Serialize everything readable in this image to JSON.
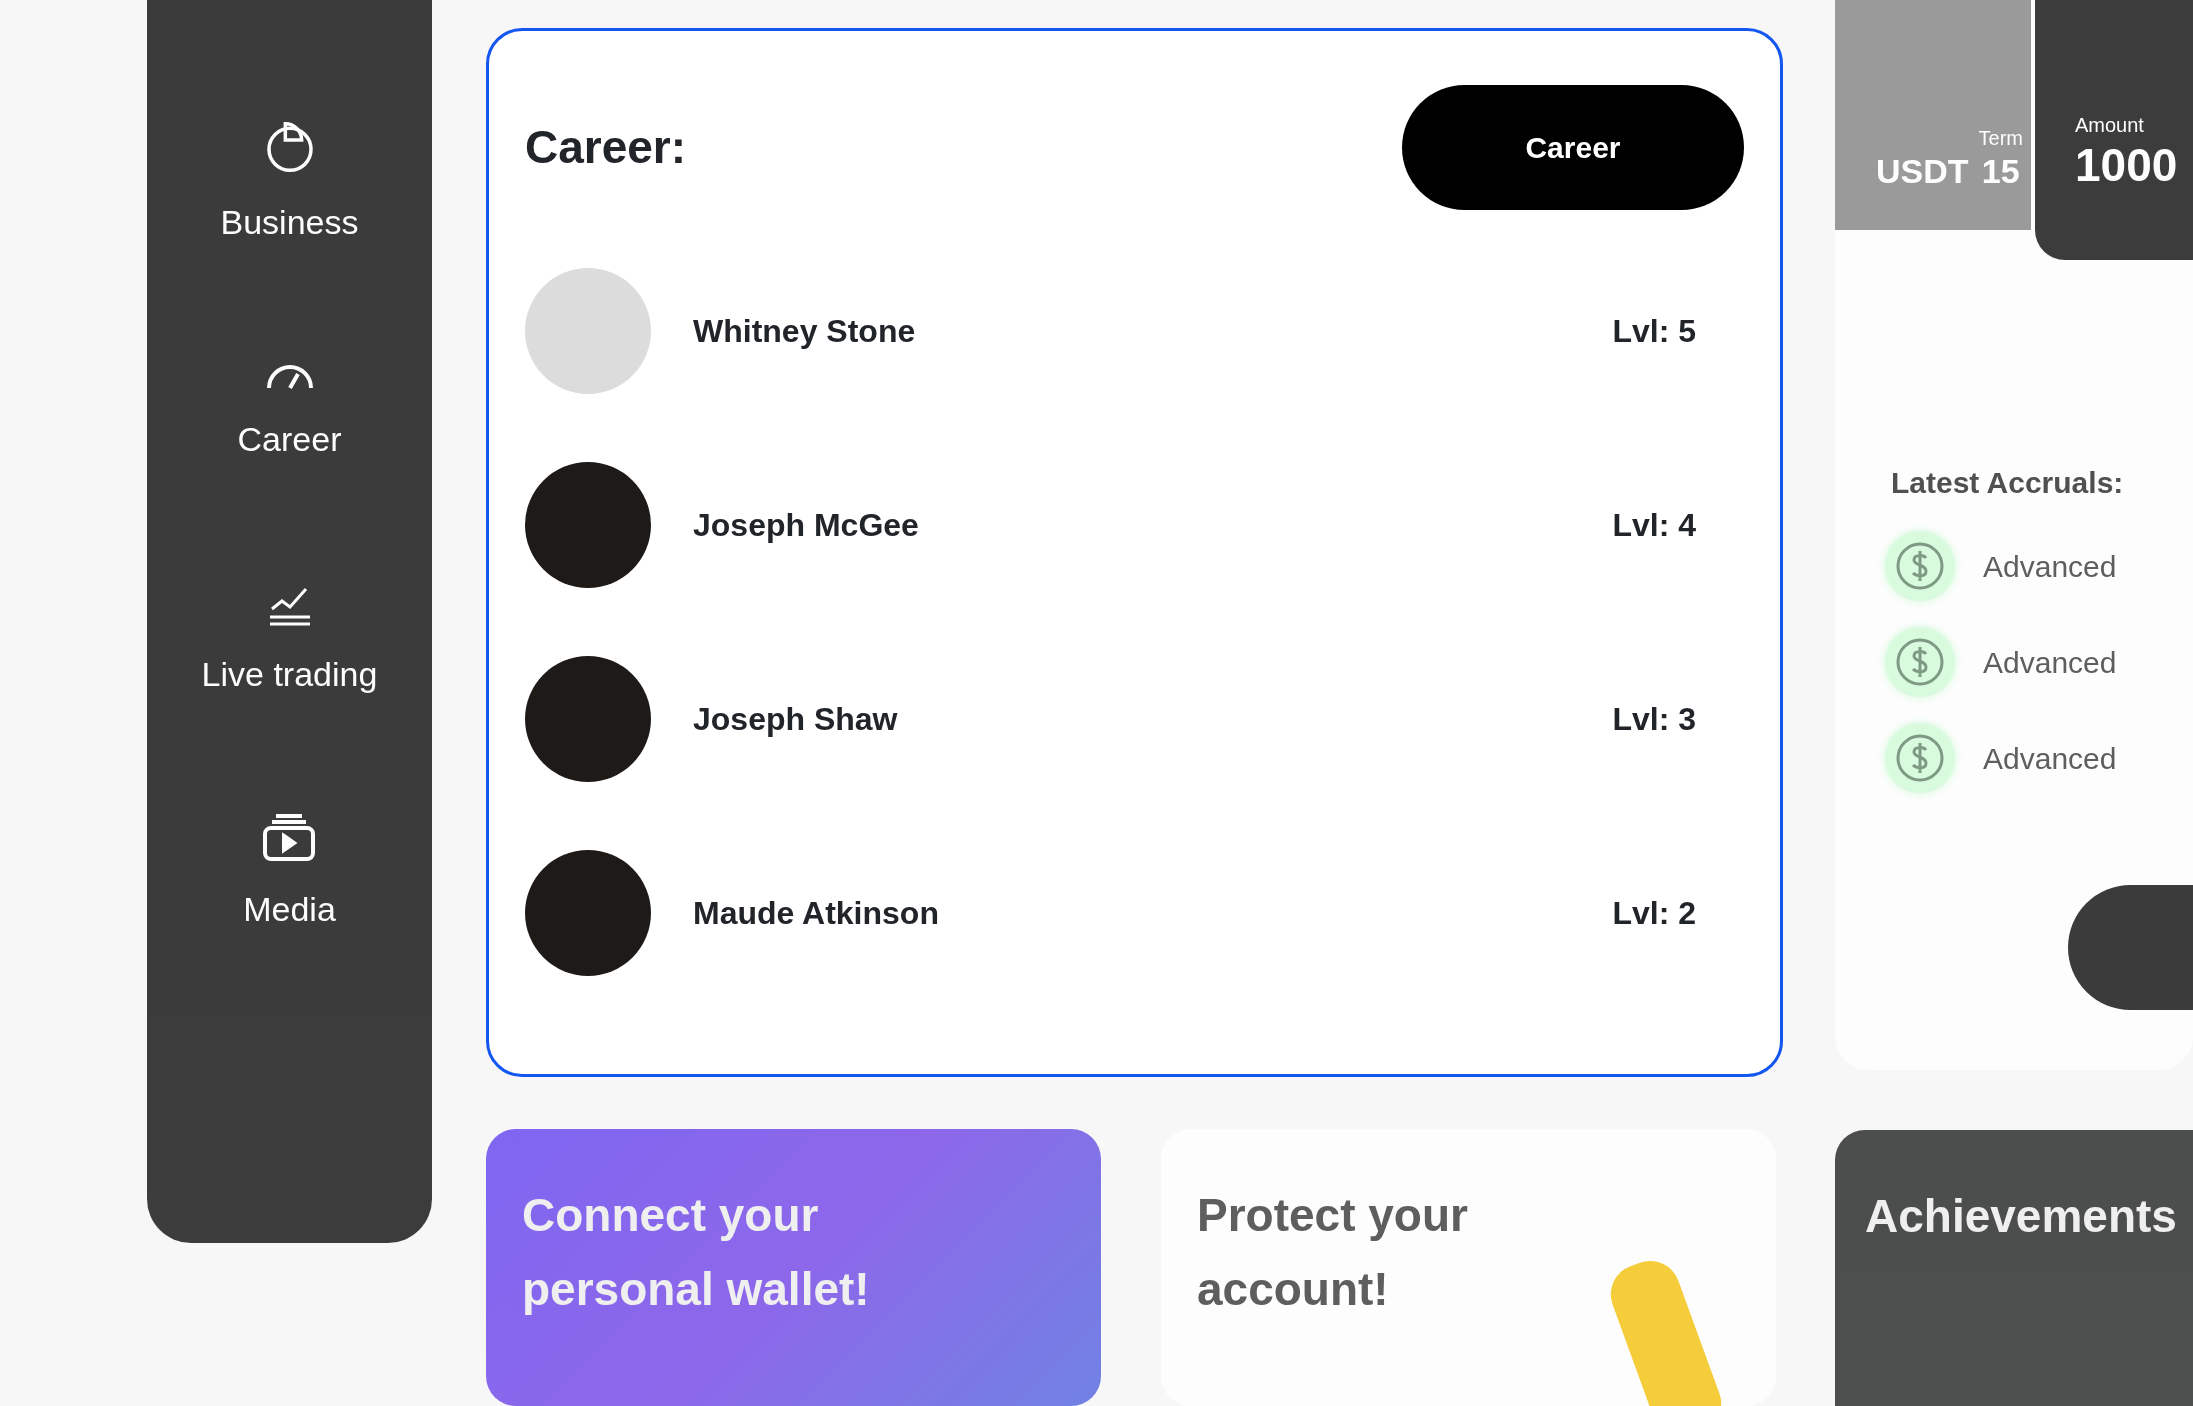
{
  "sidebar": {
    "items": [
      {
        "label": "Business"
      },
      {
        "label": "Career"
      },
      {
        "label": "Live trading"
      },
      {
        "label": "Media"
      }
    ]
  },
  "career": {
    "title": "Career:",
    "button": "Career",
    "members": [
      {
        "name": "Whitney Stone",
        "level": "Lvl: 5"
      },
      {
        "name": "Joseph McGee",
        "level": "Lvl: 4"
      },
      {
        "name": "Joseph Shaw",
        "level": "Lvl: 3"
      },
      {
        "name": "Maude Atkinson",
        "level": "Lvl: 2"
      }
    ]
  },
  "deposit": {
    "currency": "USDT",
    "term_label": "Term",
    "term": "15",
    "amount_label": "Amount",
    "amount": "1000"
  },
  "accruals": {
    "title": "Latest Accruals:",
    "items": [
      "Advanced",
      "Advanced",
      "Advanced"
    ]
  },
  "promo_cards": [
    {
      "kind": "gradient",
      "text": "Connect your personal wallet!"
    },
    {
      "kind": "light",
      "text": "Protect your account!"
    },
    {
      "kind": "dark",
      "text": "Achievements"
    }
  ]
}
